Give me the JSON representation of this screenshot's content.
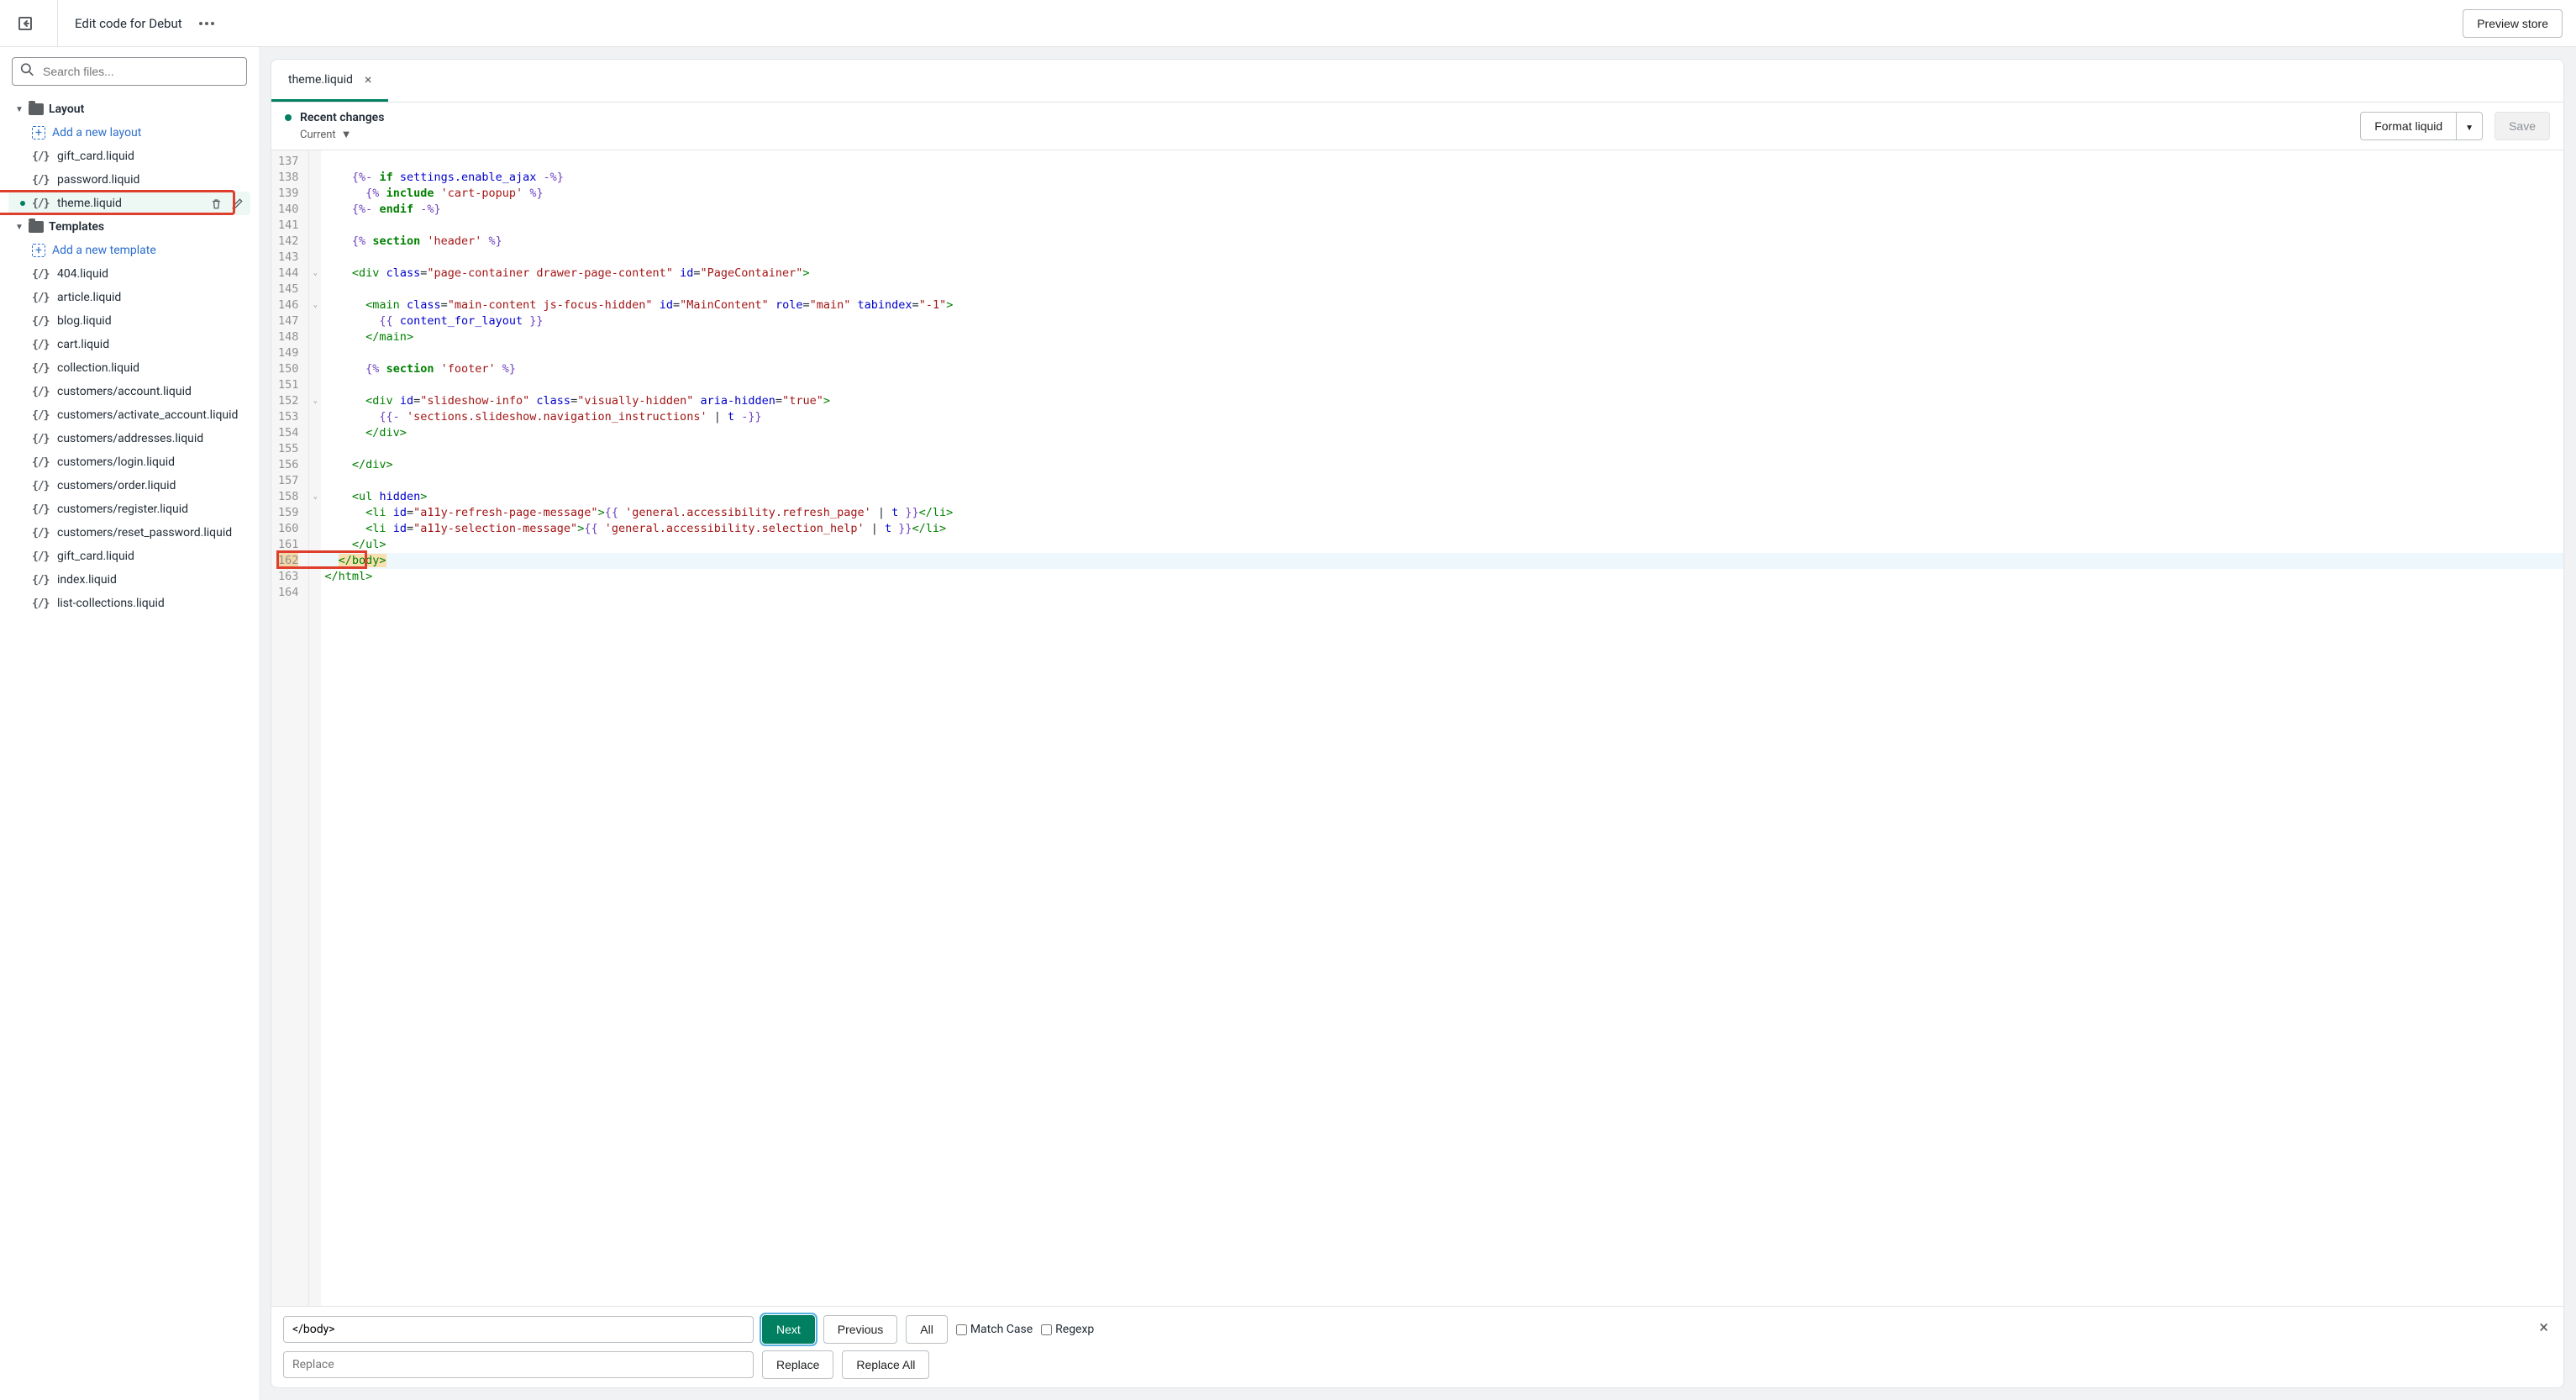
{
  "header": {
    "title": "Edit code for Debut",
    "preview_btn": "Preview store"
  },
  "sidebar": {
    "search_placeholder": "Search files...",
    "folders": [
      {
        "name": "Layout",
        "add_label": "Add a new layout",
        "files": [
          "gift_card.liquid",
          "password.liquid",
          "theme.liquid"
        ]
      },
      {
        "name": "Templates",
        "add_label": "Add a new template",
        "files": [
          "404.liquid",
          "article.liquid",
          "blog.liquid",
          "cart.liquid",
          "collection.liquid",
          "customers/account.liquid",
          "customers/activate_account.liquid",
          "customers/addresses.liquid",
          "customers/login.liquid",
          "customers/order.liquid",
          "customers/register.liquid",
          "customers/reset_password.liquid",
          "gift_card.liquid",
          "index.liquid",
          "list-collections.liquid"
        ]
      }
    ],
    "active_file": "theme.liquid"
  },
  "editor": {
    "tab_name": "theme.liquid",
    "recent_changes": "Recent changes",
    "current_label": "Current",
    "format_btn": "Format liquid",
    "save_btn": "Save",
    "first_line": 137,
    "highlighted_line": 162,
    "fold_lines": [
      144,
      146,
      152,
      158
    ],
    "code_lines_html": [
      "",
      "    <span class='t-del'>{%-</span> <span class='t-kw'>if</span> <span class='t-var'>settings.enable_ajax</span> <span class='t-del'>-%}</span>",
      "      <span class='t-del'>{%</span> <span class='t-kw'>include</span> <span class='t-str'>'cart-popup'</span> <span class='t-del'>%}</span>",
      "    <span class='t-del'>{%-</span> <span class='t-kw'>endif</span> <span class='t-del'>-%}</span>",
      "",
      "    <span class='t-del'>{%</span> <span class='t-kw'>section</span> <span class='t-str'>'header'</span> <span class='t-del'>%}</span>",
      "",
      "    <span class='t-tag'>&lt;div</span> <span class='t-attr'>class</span>=<span class='t-str'>\"page-container drawer-page-content\"</span> <span class='t-attr'>id</span>=<span class='t-str'>\"PageContainer\"</span><span class='t-tag'>&gt;</span>",
      "",
      "      <span class='t-tag'>&lt;main</span> <span class='t-attr'>class</span>=<span class='t-str'>\"main-content js-focus-hidden\"</span> <span class='t-attr'>id</span>=<span class='t-str'>\"MainContent\"</span> <span class='t-attr'>role</span>=<span class='t-str'>\"main\"</span> <span class='t-attr'>tabindex</span>=<span class='t-str'>\"-1\"</span><span class='t-tag'>&gt;</span>",
      "        <span class='t-del'>{{</span> <span class='t-var'>content_for_layout</span> <span class='t-del'>}}</span>",
      "      <span class='t-tag'>&lt;/main&gt;</span>",
      "",
      "      <span class='t-del'>{%</span> <span class='t-kw'>section</span> <span class='t-str'>'footer'</span> <span class='t-del'>%}</span>",
      "",
      "      <span class='t-tag'>&lt;div</span> <span class='t-attr'>id</span>=<span class='t-str'>\"slideshow-info\"</span> <span class='t-attr'>class</span>=<span class='t-str'>\"visually-hidden\"</span> <span class='t-attr'>aria-hidden</span>=<span class='t-str'>\"true\"</span><span class='t-tag'>&gt;</span>",
      "        <span class='t-del'>{{-</span> <span class='t-str'>'sections.slideshow.navigation_instructions'</span> | <span class='t-var'>t</span> <span class='t-del'>-}}</span>",
      "      <span class='t-tag'>&lt;/div&gt;</span>",
      "",
      "    <span class='t-tag'>&lt;/div&gt;</span>",
      "",
      "    <span class='t-tag'>&lt;ul</span> <span class='t-attr'>hidden</span><span class='t-tag'>&gt;</span>",
      "      <span class='t-tag'>&lt;li</span> <span class='t-attr'>id</span>=<span class='t-str'>\"a11y-refresh-page-message\"</span><span class='t-tag'>&gt;</span><span class='t-del'>{{</span> <span class='t-str'>'general.accessibility.refresh_page'</span> | <span class='t-var'>t</span> <span class='t-del'>}}</span><span class='t-tag'>&lt;/li&gt;</span>",
      "      <span class='t-tag'>&lt;li</span> <span class='t-attr'>id</span>=<span class='t-str'>\"a11y-selection-message\"</span><span class='t-tag'>&gt;</span><span class='t-del'>{{</span> <span class='t-str'>'general.accessibility.selection_help'</span> | <span class='t-var'>t</span> <span class='t-del'>}}</span><span class='t-tag'>&lt;/li&gt;</span>",
      "    <span class='t-tag'>&lt;/ul&gt;</span>",
      "  <span class='sel-highlight'><span class='t-tag'>&lt;/body&gt;</span></span>",
      "<span class='t-tag'>&lt;/html&gt;</span>",
      ""
    ]
  },
  "search": {
    "find_value": "</body>",
    "replace_placeholder": "Replace",
    "next_btn": "Next",
    "prev_btn": "Previous",
    "all_btn": "All",
    "replace_btn": "Replace",
    "replace_all_btn": "Replace All",
    "match_case": "Match Case",
    "regexp": "Regexp"
  }
}
